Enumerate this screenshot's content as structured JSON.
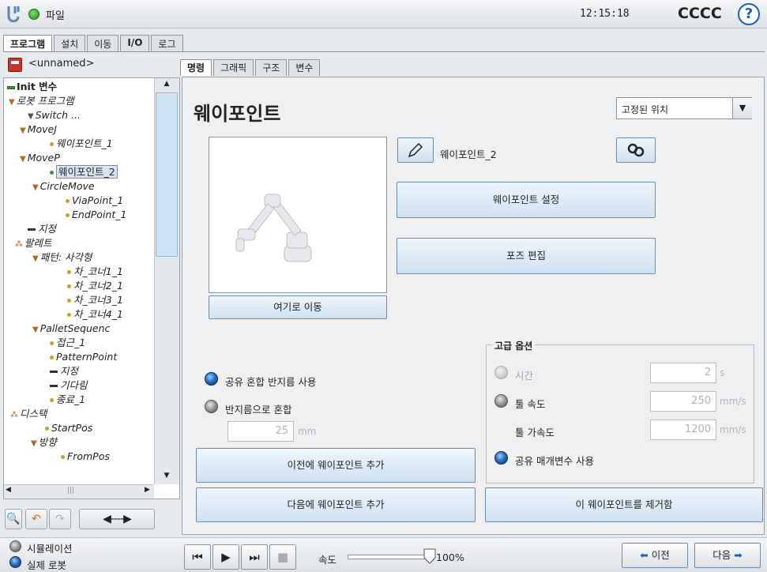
{
  "topbar": {
    "file_menu": "파일",
    "time": "12:15:18",
    "robot_name": "CCCC",
    "help": "?"
  },
  "main_tabs": [
    "프로그램",
    "설치",
    "이동",
    "I/O",
    "로그"
  ],
  "file": {
    "name": "<unnamed>"
  },
  "tree": {
    "init": "Init 변수",
    "items": [
      "로봇 프로그램",
      "Switch ...",
      "MoveJ",
      "웨이포인트_1",
      "MoveP",
      "웨이포인트_2",
      "CircleMove",
      "ViaPoint_1",
      "EndPoint_1",
      "지정",
      "팔레트",
      "패턴: 사각형",
      "차_코너1_1",
      "차_코너2_1",
      "차_코너3_1",
      "차_코너4_1",
      "PalletSequenc",
      "접근_1",
      "PatternPoint",
      "지정",
      "기다림",
      "종료_1",
      "디스택",
      "StartPos",
      "방향",
      "FromPos"
    ]
  },
  "sub_tabs": [
    "명령",
    "그래픽",
    "구조",
    "변수"
  ],
  "waypoint": {
    "title": "웨이포인트",
    "position_type": "고정된 위치",
    "name": "웨이포인트_2",
    "set_waypoint": "웨이포인트 설정",
    "edit_pose": "포즈 편집",
    "move_here": "여기로 이동"
  },
  "blend": {
    "shared": "공유 혼합 반지름 사용",
    "radius": "반지름으로 혼합",
    "radius_value": "25",
    "radius_unit": "mm"
  },
  "advanced": {
    "legend": "고급 옵션",
    "time_label": "시간",
    "time_value": "2",
    "time_unit": "s",
    "tool_speed_label": "툴 속도",
    "tool_speed_value": "250",
    "tool_speed_unit": "mm/s",
    "tool_accel_label": "툴 가속도",
    "tool_accel_value": "1200",
    "tool_accel_unit": "mm/s",
    "shared_params": "공유 매개변수 사용"
  },
  "actions": {
    "add_before": "이전에 웨이포인트 추가",
    "add_after": "다음에 웨이포인트 추가",
    "remove": "이 웨이포인트를 제거함"
  },
  "bottom": {
    "simulation": "시뮬레이션",
    "real_robot": "실제 로봇",
    "speed_label": "속도",
    "speed_value": "100%",
    "speed_fraction": 1.0,
    "prev": "이전",
    "next": "다음"
  }
}
